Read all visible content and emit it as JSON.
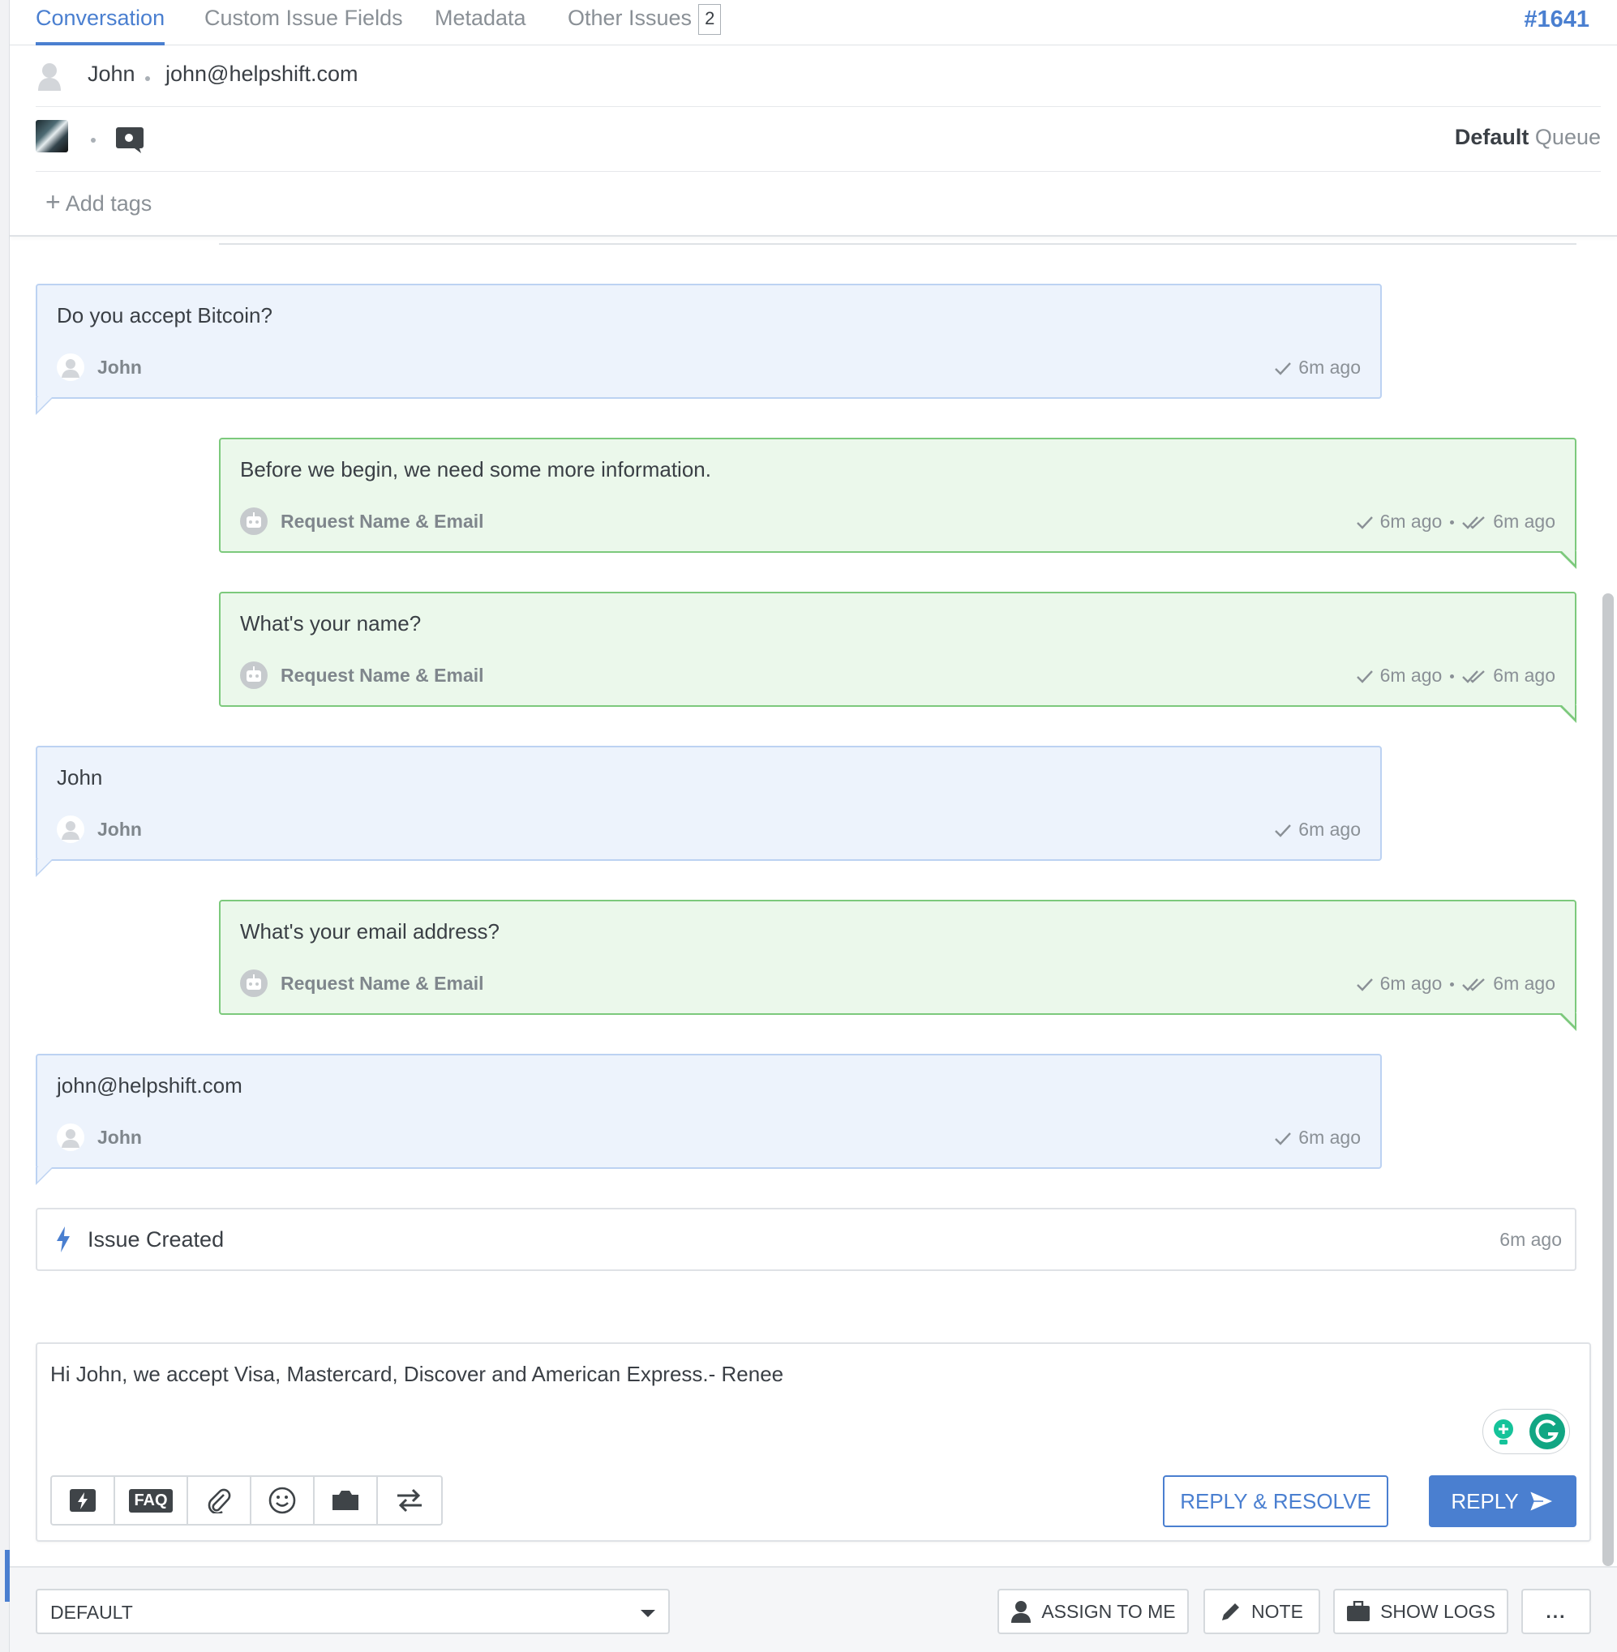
{
  "tabs": [
    {
      "label": "Conversation",
      "active": true
    },
    {
      "label": "Custom Issue Fields",
      "active": false
    },
    {
      "label": "Metadata",
      "active": false
    },
    {
      "label": "Other Issues",
      "active": false,
      "count": "2"
    }
  ],
  "issue_id": "#1641",
  "user": {
    "name": "John",
    "email": "john@helpshift.com"
  },
  "queue": {
    "name": "Default",
    "suffix": "Queue"
  },
  "tags": {
    "add_label": "Add tags"
  },
  "messages": [
    {
      "kind": "user",
      "text": "Do you accept Bitcoin?",
      "author": "John",
      "time": "6m ago"
    },
    {
      "kind": "bot",
      "text": "Before we begin, we need some more information.",
      "author": "Request Name & Email",
      "sent": "6m ago",
      "read": "6m ago"
    },
    {
      "kind": "bot",
      "text": "What's your name?",
      "author": "Request Name & Email",
      "sent": "6m ago",
      "read": "6m ago"
    },
    {
      "kind": "user",
      "text": "John",
      "author": "John",
      "time": "6m ago"
    },
    {
      "kind": "bot",
      "text": "What's your email address?",
      "author": "Request Name & Email",
      "sent": "6m ago",
      "read": "6m ago"
    },
    {
      "kind": "user",
      "text": "john@helpshift.com",
      "author": "John",
      "time": "6m ago"
    }
  ],
  "event": {
    "label": "Issue Created",
    "time": "6m ago"
  },
  "composer": {
    "text": "Hi John, we accept Visa, Mastercard, Discover and American Express.- Renee",
    "tools": [
      "lightning-icon",
      "FAQ",
      "paperclip-icon",
      "smiley-icon",
      "camera-icon",
      "swap-icon"
    ],
    "faq_label": "FAQ",
    "reply_resolve_label": "REPLY & RESOLVE",
    "reply_label": "REPLY"
  },
  "footer": {
    "select_value": "DEFAULT",
    "assign_label": "ASSIGN TO ME",
    "note_label": "NOTE",
    "logs_label": "SHOW LOGS",
    "more_label": "..."
  },
  "colors": {
    "accent": "#4a7fd0",
    "user_bubble": "#edf3fc",
    "bot_bubble": "#ebf8eb",
    "bot_border": "#7cc97c"
  }
}
